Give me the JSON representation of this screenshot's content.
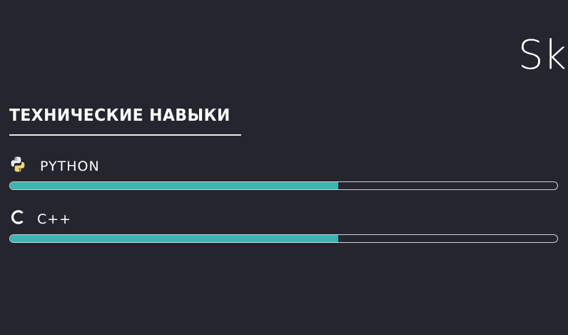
{
  "header": {
    "partial_title": "Sk"
  },
  "skills_section": {
    "title": "ТЕХНИЧЕСКИЕ НАВЫКИ",
    "items": [
      {
        "label": "PYTHON",
        "icon": "python-icon",
        "progress": 0.6
      },
      {
        "label": "C++",
        "icon": "c-letter-icon",
        "progress": 0.6
      }
    ]
  },
  "colors": {
    "background": "#23262e",
    "progress_fill": "#3cb4b2",
    "progress_border": "#cfd3d6",
    "text": "#ffffff"
  }
}
